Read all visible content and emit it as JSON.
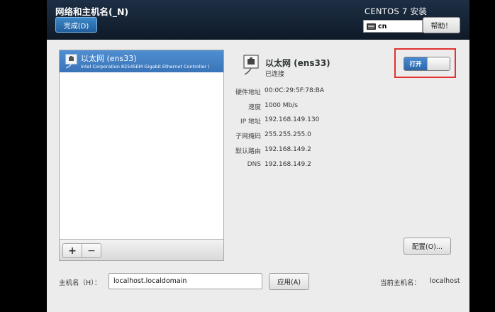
{
  "header": {
    "title": "网络和主机名(_N)",
    "done_label": "完成(D)",
    "product": "CENTOS 7 安装",
    "keyboard_layout": "cn",
    "help_label": "帮助！"
  },
  "device_list": {
    "items": [
      {
        "name": "以太网 (ens33)",
        "description": "Intel Corporation 82545EM Gigabit Ethernet Controller ("
      }
    ],
    "add_label": "+",
    "remove_label": "−"
  },
  "device": {
    "name": "以太网 (ens33)",
    "status": "已连接",
    "toggle_label": "打开",
    "toggle_on": true,
    "details": [
      {
        "label": "硬件地址",
        "value": "00:0C:29:5F:78:BA"
      },
      {
        "label": "速度",
        "value": "1000 Mb/s"
      },
      {
        "label": "IP 地址",
        "value": "192.168.149.130"
      },
      {
        "label": "子网掩码",
        "value": "255.255.255.0"
      },
      {
        "label": "默认路由",
        "value": "192.168.149.2"
      },
      {
        "label": "DNS",
        "value": "192.168.149.2"
      }
    ],
    "config_label": "配置(O)..."
  },
  "hostname": {
    "label": "主机名（H）：",
    "value": "localhost.localdomain",
    "apply_label": "应用(A)",
    "current_label": "当前主机名：",
    "current_value": "localhost"
  },
  "colors": {
    "accent": "#3a74b8",
    "header_bg": "#16263a",
    "highlight": "#e23232"
  }
}
